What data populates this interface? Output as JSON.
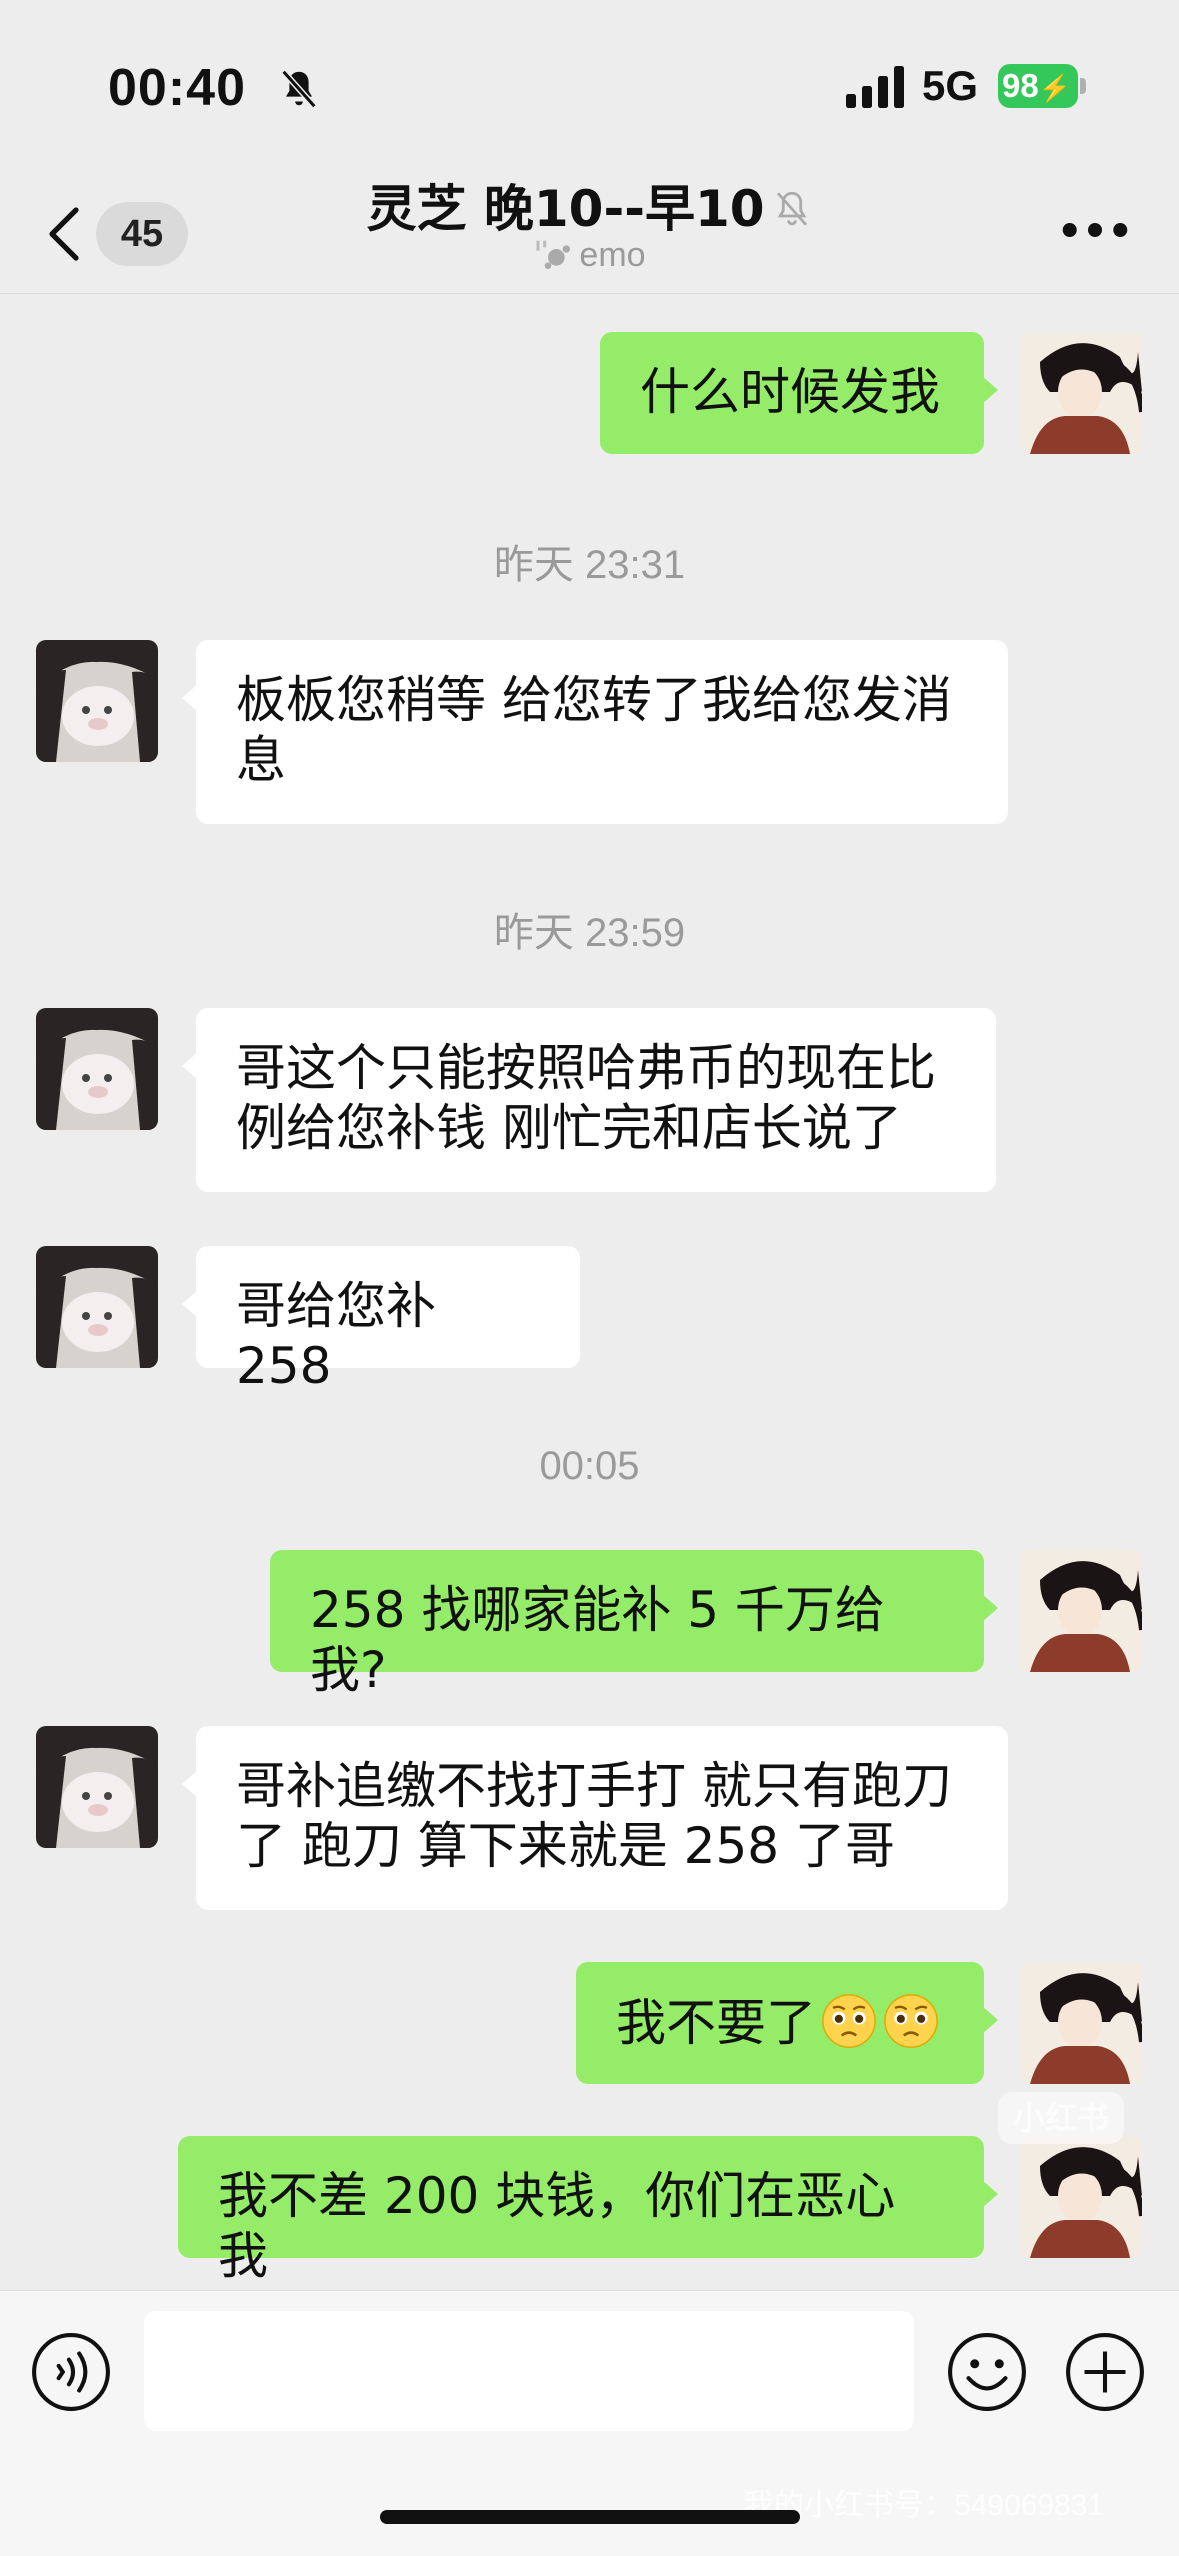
{
  "status_bar": {
    "time": "00:40",
    "network": "5G",
    "battery": "98",
    "icons": [
      "bell-slash-icon",
      "signal-bars-icon",
      "battery-charging-icon"
    ]
  },
  "nav": {
    "unread_count": "45",
    "title": "灵芝 晚10--早10",
    "subtitle": "emo",
    "icons": [
      "chevron-left-icon",
      "bell-slash-icon",
      "status-emo-icon",
      "more-dots-icon"
    ]
  },
  "messages": [
    {
      "sender": "me",
      "text": "什么时候发我"
    },
    {
      "type": "time",
      "text": "昨天 23:31"
    },
    {
      "sender": "other",
      "lines": [
        "板板您稍等 给您转了我给您发消",
        "息"
      ]
    },
    {
      "type": "time",
      "text": "昨天 23:59"
    },
    {
      "sender": "other",
      "lines": [
        "哥这个只能按照哈弗币的现在比",
        "例给您补钱 刚忙完和店长说了"
      ]
    },
    {
      "sender": "other",
      "text": "哥给您补 258"
    },
    {
      "type": "time",
      "text": "00:05"
    },
    {
      "sender": "me",
      "text": "258 找哪家能补 5 千万给我?"
    },
    {
      "sender": "other",
      "lines": [
        "哥补追缴不找打手打 就只有跑刀",
        "了 跑刀 算下来就是 258 了哥"
      ]
    },
    {
      "sender": "me",
      "text": "我不要了",
      "emoji": "pleading-face-emoji"
    },
    {
      "sender": "me",
      "text": "我不差 200 块钱，你们在恶心我"
    }
  ],
  "input_bar": {
    "placeholder": "",
    "icons": [
      "voice-icon",
      "emoji-smile-icon",
      "plus-icon"
    ]
  },
  "watermark": {
    "logo": "小红书",
    "text": "我的小红书号：549069831"
  },
  "colors": {
    "background": "#ededed",
    "my_bubble": "#95ec69",
    "their_bubble": "#ffffff",
    "battery": "#34c759"
  }
}
